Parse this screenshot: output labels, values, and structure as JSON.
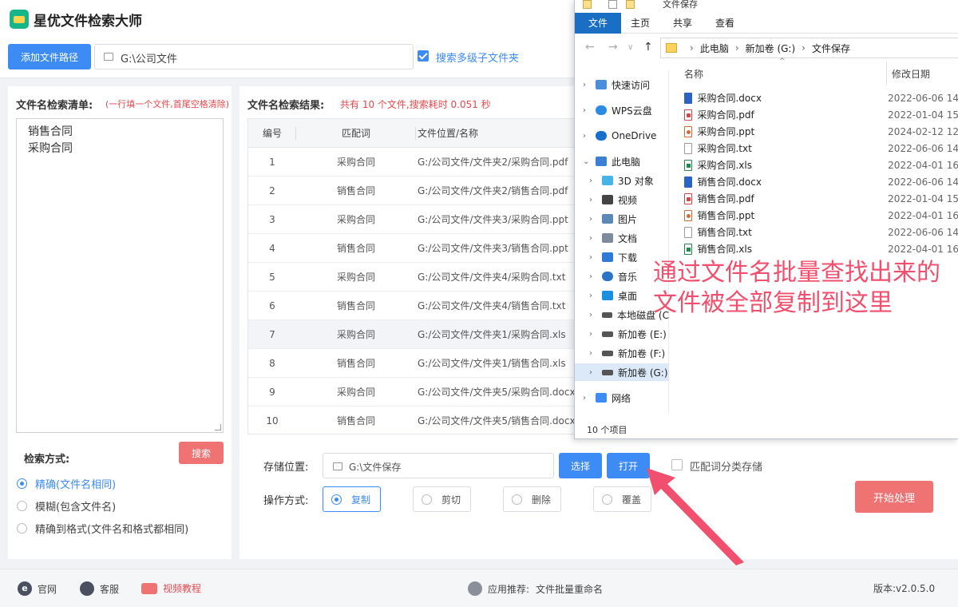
{
  "app": {
    "title": "星优文件检索大师",
    "add_path_button": "添加文件路径",
    "path_value": "G:\\公司文件",
    "search_subfolders_label": "搜索多级子文件夹",
    "search_subfolders_checked": true
  },
  "left": {
    "title": "文件名检索清单:",
    "hint": "(一行填一个文件,首尾空格清除)",
    "names": [
      "销售合同",
      "采购合同"
    ],
    "search_button": "搜索",
    "mode_title": "检索方式:",
    "modes": [
      {
        "label": "精确(文件名相同)",
        "selected": true
      },
      {
        "label": "模糊(包含文件名)",
        "selected": false
      },
      {
        "label": "精确到格式(文件名和格式都相同)",
        "selected": false
      }
    ]
  },
  "results": {
    "title": "文件名检索结果:",
    "summary": "共有 10 个文件,搜索耗时 0.051 秒",
    "columns": [
      "编号",
      "匹配词",
      "文件位置/名称"
    ],
    "rows": [
      {
        "no": "1",
        "word": "采购合同",
        "path": "G:/公司文件/文件夹2/采购合同.pdf"
      },
      {
        "no": "2",
        "word": "销售合同",
        "path": "G:/公司文件/文件夹2/销售合同.pdf"
      },
      {
        "no": "3",
        "word": "采购合同",
        "path": "G:/公司文件/文件夹3/采购合同.ppt"
      },
      {
        "no": "4",
        "word": "销售合同",
        "path": "G:/公司文件/文件夹3/销售合同.ppt"
      },
      {
        "no": "5",
        "word": "采购合同",
        "path": "G:/公司文件/文件夹4/采购合同.txt"
      },
      {
        "no": "6",
        "word": "销售合同",
        "path": "G:/公司文件/文件夹4/销售合同.txt"
      },
      {
        "no": "7",
        "word": "采购合同",
        "path": "G:/公司文件/文件夹1/采购合同.xls"
      },
      {
        "no": "8",
        "word": "销售合同",
        "path": "G:/公司文件/文件夹1/销售合同.xls"
      },
      {
        "no": "9",
        "word": "采购合同",
        "path": "G:/公司文件/文件夹5/采购合同.docx"
      },
      {
        "no": "10",
        "word": "销售合同",
        "path": "G:/公司文件/文件夹5/销售合同.docx"
      }
    ],
    "store_label": "存储位置:",
    "store_value": "G:\\文件保存",
    "choose_button": "选择",
    "open_button": "打开",
    "classify_label": "匹配词分类存储",
    "classify_checked": false,
    "op_label": "操作方式:",
    "ops": [
      {
        "label": "复制",
        "selected": true
      },
      {
        "label": "剪切",
        "selected": false
      },
      {
        "label": "删除",
        "selected": false
      },
      {
        "label": "覆盖",
        "selected": false
      }
    ],
    "start_button": "开始处理"
  },
  "footer": {
    "site": "官网",
    "service": "客服",
    "video": "视频教程",
    "recommend_label": "应用推荐:",
    "recommend_app": "文件批量重命名",
    "version": "版本:v2.0.5.0"
  },
  "explorer": {
    "title": "文件保存",
    "ribbon_tabs": [
      "文件",
      "主页",
      "共享",
      "查看"
    ],
    "address": [
      "此电脑",
      "新加卷 (G:)",
      "文件保存"
    ],
    "tree": [
      {
        "label": "快速访问",
        "icon": "star-icon"
      },
      {
        "label": "WPS云盘",
        "icon": "cloud-icon"
      },
      {
        "label": "OneDrive",
        "icon": "onedrive-icon"
      },
      {
        "label": "此电脑",
        "icon": "computer-icon"
      },
      {
        "label": "3D 对象",
        "icon": "cube-icon"
      },
      {
        "label": "视频",
        "icon": "video-icon"
      },
      {
        "label": "图片",
        "icon": "picture-icon"
      },
      {
        "label": "文档",
        "icon": "document-icon"
      },
      {
        "label": "下载",
        "icon": "download-icon"
      },
      {
        "label": "音乐",
        "icon": "music-icon"
      },
      {
        "label": "桌面",
        "icon": "desktop-icon"
      },
      {
        "label": "本地磁盘 (C",
        "icon": "drive-icon"
      },
      {
        "label": "新加卷 (E:)",
        "icon": "drive-icon"
      },
      {
        "label": "新加卷 (F:)",
        "icon": "drive-icon"
      },
      {
        "label": "新加卷 (G:)",
        "icon": "drive-icon"
      },
      {
        "label": "网络",
        "icon": "network-icon"
      }
    ],
    "col_name": "名称",
    "col_date": "修改日期",
    "files": [
      {
        "name": "采购合同.docx",
        "date": "2022-06-06 14",
        "type": "word"
      },
      {
        "name": "采购合同.pdf",
        "date": "2022-01-04 15",
        "type": "pdf"
      },
      {
        "name": "采购合同.ppt",
        "date": "2024-02-12 12",
        "type": "ppt"
      },
      {
        "name": "采购合同.txt",
        "date": "2022-06-06 14",
        "type": "txt"
      },
      {
        "name": "采购合同.xls",
        "date": "2022-04-01 16",
        "type": "xls"
      },
      {
        "name": "销售合同.docx",
        "date": "2022-06-06 14",
        "type": "word"
      },
      {
        "name": "销售合同.pdf",
        "date": "2022-01-04 15",
        "type": "pdf"
      },
      {
        "name": "销售合同.ppt",
        "date": "2022-04-01 16",
        "type": "ppt"
      },
      {
        "name": "销售合同.txt",
        "date": "2022-06-06 14",
        "type": "txt"
      },
      {
        "name": "销售合同.xls",
        "date": "2022-04-01 16",
        "type": "xls"
      }
    ],
    "status": "10 个项目"
  },
  "annotation": {
    "text": "通过文件名批量查找出来的文件被全部复制到这里",
    "color": "#f0506e"
  },
  "colors": {
    "primary": "#3d8bf5",
    "danger": "#f07374",
    "hint_red": "#e5484d"
  }
}
